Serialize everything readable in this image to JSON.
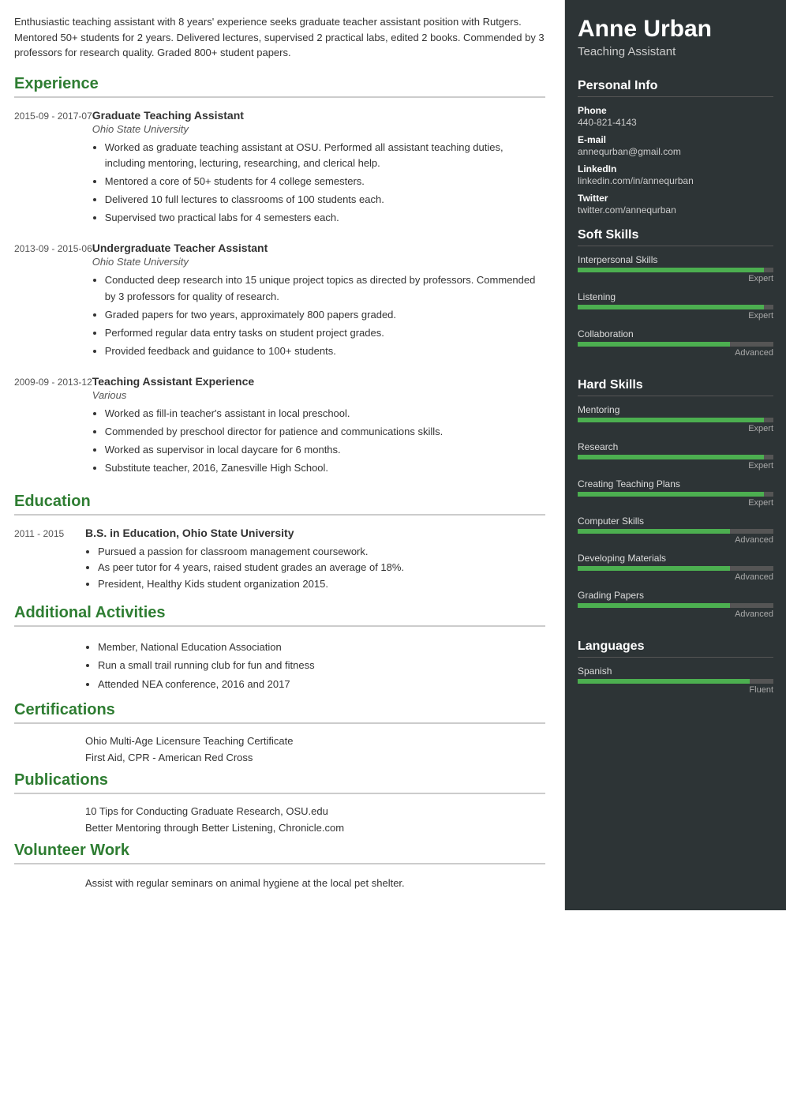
{
  "summary": "Enthusiastic teaching assistant with 8 years' experience seeks graduate teacher assistant position with Rutgers. Mentored 50+ students for 2 years. Delivered lectures, supervised 2 practical labs, edited 2 books. Commended by 3 professors for research quality. Graded 800+ student papers.",
  "sections": {
    "experience": {
      "title": "Experience",
      "entries": [
        {
          "date": "2015-09 - 2017-07",
          "title": "Graduate Teaching Assistant",
          "org": "Ohio State University",
          "bullets": [
            "Worked as graduate teaching assistant at OSU. Performed all assistant teaching duties, including mentoring, lecturing, researching, and clerical help.",
            "Mentored a core of 50+ students for 4 college semesters.",
            "Delivered 10 full lectures to classrooms of 100 students each.",
            "Supervised two practical labs for 4 semesters each."
          ]
        },
        {
          "date": "2013-09 - 2015-06",
          "title": "Undergraduate Teacher Assistant",
          "org": "Ohio State University",
          "bullets": [
            "Conducted deep research into 15 unique project topics as directed by professors. Commended by 3 professors for quality of research.",
            "Graded papers for two years, approximately 800 papers graded.",
            "Performed regular data entry tasks on student project grades.",
            "Provided feedback and guidance to 100+ students."
          ]
        },
        {
          "date": "2009-09 - 2013-12",
          "title": "Teaching Assistant Experience",
          "org": "Various",
          "bullets": [
            "Worked as fill-in teacher's assistant in local preschool.",
            "Commended by preschool director for patience and communications skills.",
            "Worked as supervisor in local daycare for 6 months.",
            "Substitute teacher, 2016, Zanesville High School."
          ]
        }
      ]
    },
    "education": {
      "title": "Education",
      "entries": [
        {
          "date": "2011 - 2015",
          "title": "B.S. in Education, Ohio State University",
          "bullets": [
            "Pursued a passion for classroom management coursework.",
            "As peer tutor for 4 years, raised student grades an average of 18%.",
            "President, Healthy Kids student organization 2015."
          ]
        }
      ]
    },
    "activities": {
      "title": "Additional Activities",
      "items": [
        "Member, National Education Association",
        "Run a small trail running club for fun and fitness",
        "Attended NEA conference, 2016 and 2017"
      ]
    },
    "certifications": {
      "title": "Certifications",
      "items": [
        "Ohio Multi-Age Licensure Teaching Certificate",
        "First Aid, CPR - American Red Cross"
      ]
    },
    "publications": {
      "title": "Publications",
      "items": [
        "10 Tips for Conducting Graduate Research, OSU.edu",
        "Better Mentoring through Better Listening, Chronicle.com"
      ]
    },
    "volunteer": {
      "title": "Volunteer Work",
      "items": [
        "Assist with regular seminars on animal hygiene at the local pet shelter."
      ]
    }
  },
  "sidebar": {
    "name": "Anne Urban",
    "job_title": "Teaching Assistant",
    "personal_info": {
      "title": "Personal Info",
      "phone_label": "Phone",
      "phone": "440-821-4143",
      "email_label": "E-mail",
      "email": "annequrban@gmail.com",
      "linkedin_label": "LinkedIn",
      "linkedin": "linkedin.com/in/annequrban",
      "twitter_label": "Twitter",
      "twitter": "twitter.com/annequrban"
    },
    "soft_skills": {
      "title": "Soft Skills",
      "items": [
        {
          "name": "Interpersonal Skills",
          "level": "Expert",
          "pct": 95
        },
        {
          "name": "Listening",
          "level": "Expert",
          "pct": 95
        },
        {
          "name": "Collaboration",
          "level": "Advanced",
          "pct": 78
        }
      ]
    },
    "hard_skills": {
      "title": "Hard Skills",
      "items": [
        {
          "name": "Mentoring",
          "level": "Expert",
          "pct": 95
        },
        {
          "name": "Research",
          "level": "Expert",
          "pct": 95
        },
        {
          "name": "Creating Teaching Plans",
          "level": "Expert",
          "pct": 95
        },
        {
          "name": "Computer Skills",
          "level": "Advanced",
          "pct": 78
        },
        {
          "name": "Developing Materials",
          "level": "Advanced",
          "pct": 78
        },
        {
          "name": "Grading Papers",
          "level": "Advanced",
          "pct": 78
        }
      ]
    },
    "languages": {
      "title": "Languages",
      "items": [
        {
          "name": "Spanish",
          "level": "Fluent",
          "pct": 88
        }
      ]
    }
  }
}
